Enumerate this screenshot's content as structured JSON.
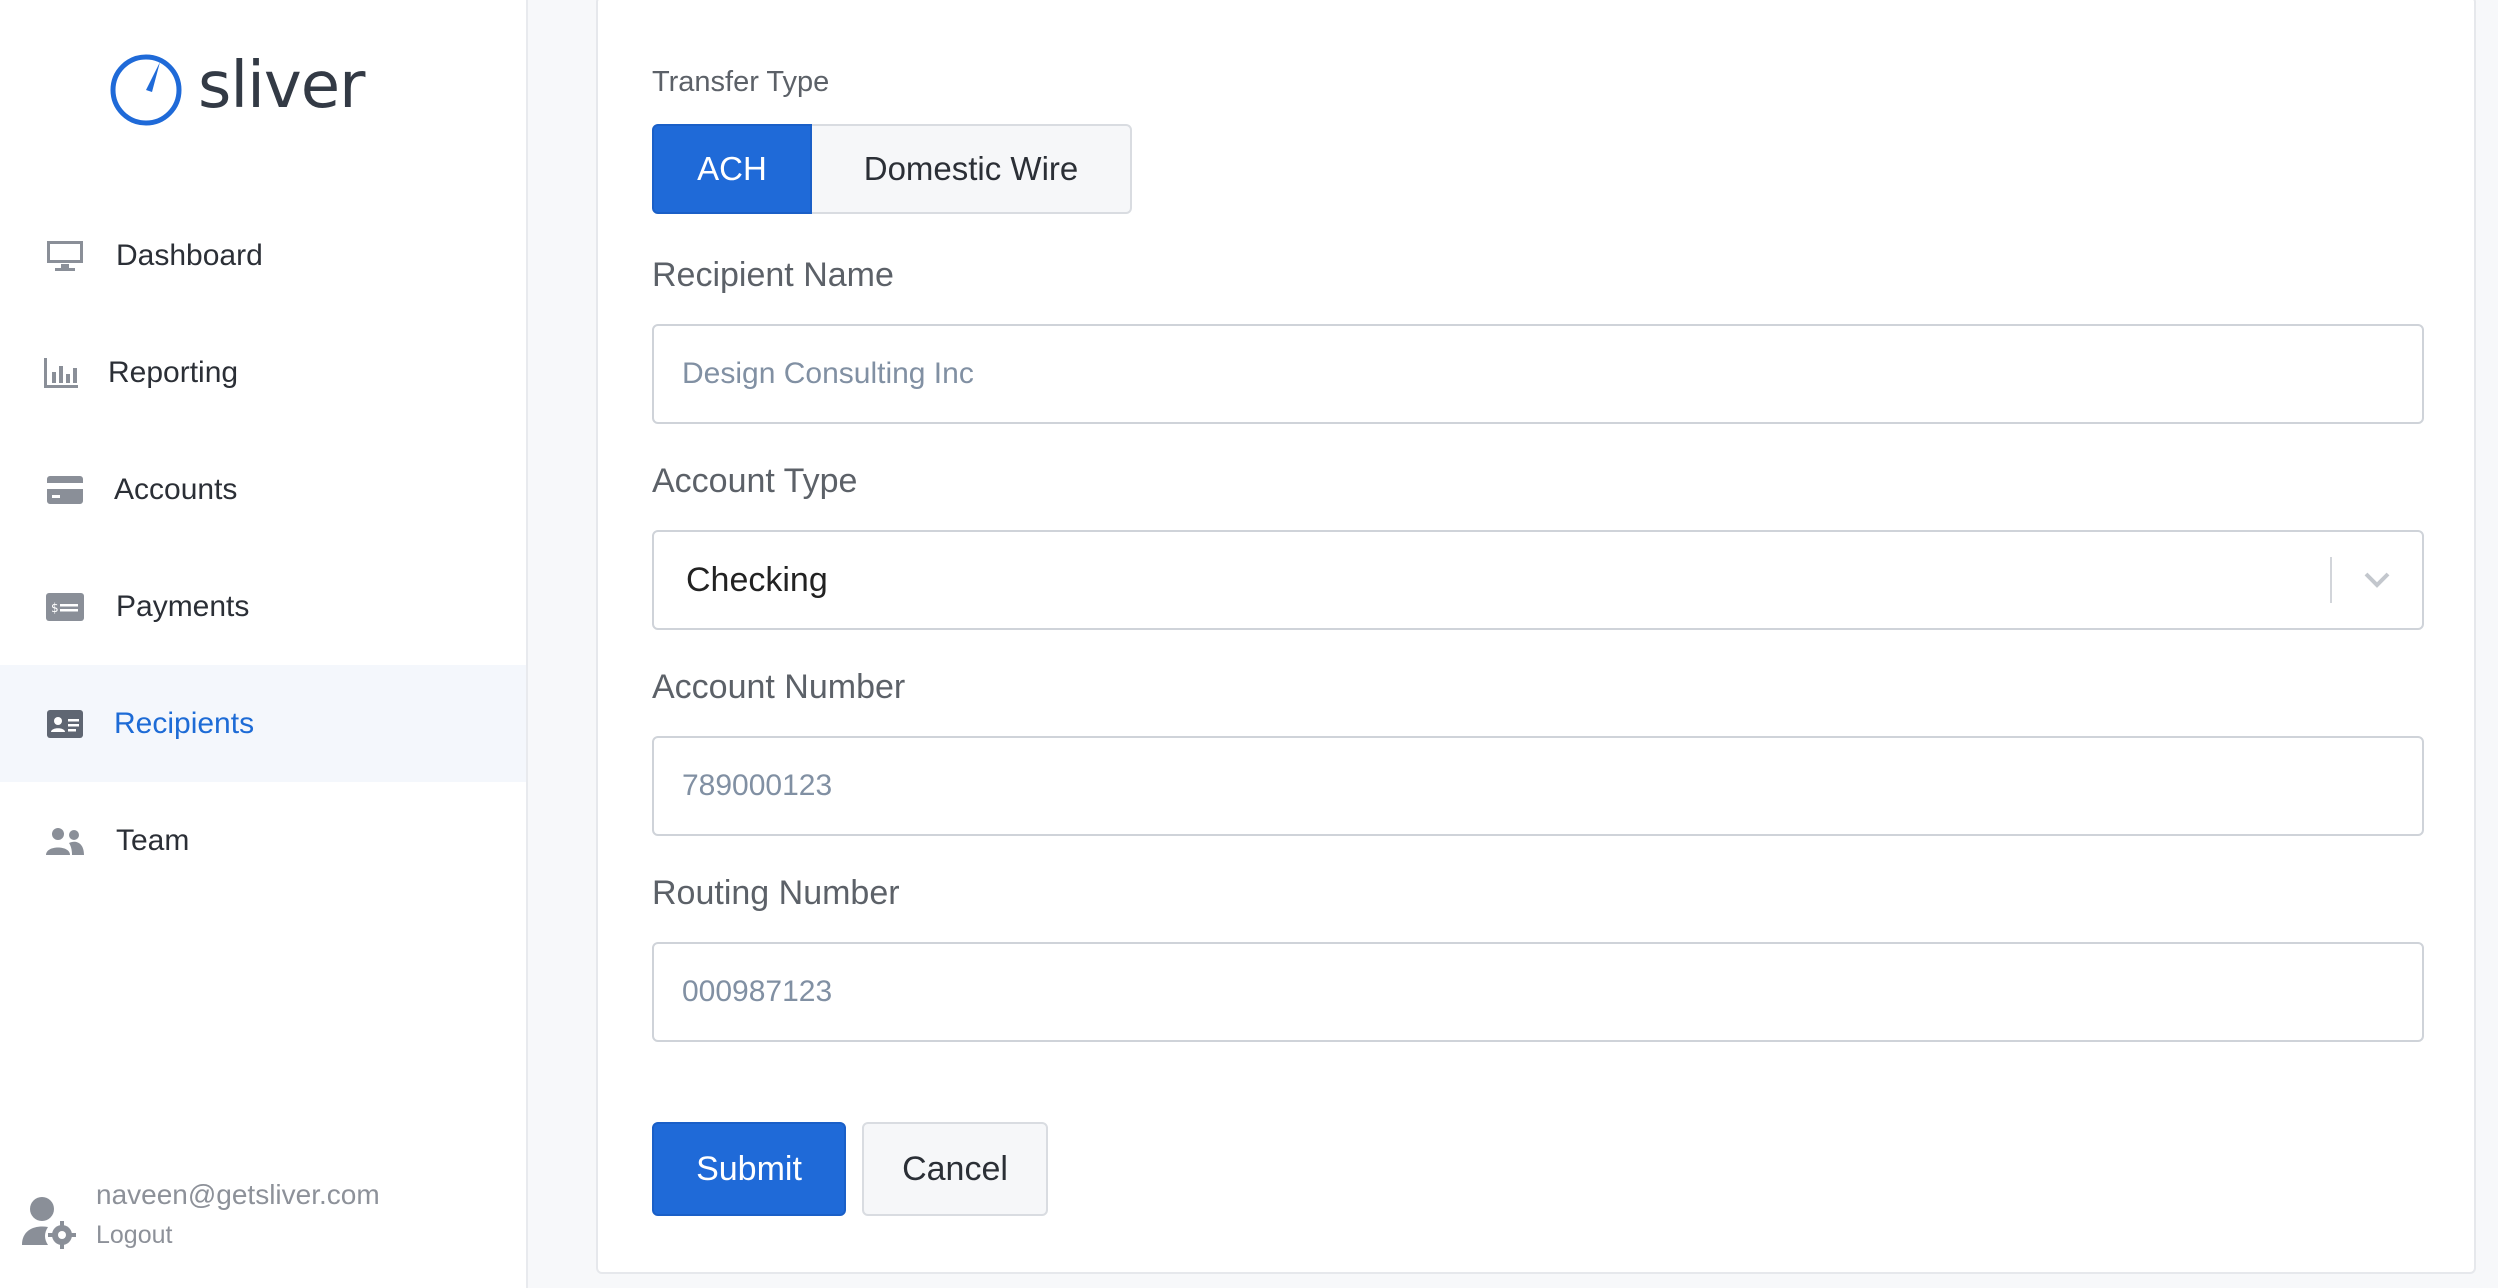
{
  "app": {
    "logo_text": "sliver",
    "accent": "#1f6ad8"
  },
  "sidebar": {
    "items": [
      {
        "label": "Dashboard",
        "icon": "monitor-icon"
      },
      {
        "label": "Reporting",
        "icon": "bar-chart-icon"
      },
      {
        "label": "Accounts",
        "icon": "credit-card-icon"
      },
      {
        "label": "Payments",
        "icon": "money-check-icon"
      },
      {
        "label": "Recipients",
        "icon": "id-card-icon",
        "active": true
      },
      {
        "label": "Team",
        "icon": "users-icon"
      }
    ],
    "user": {
      "email": "naveen@getsliver.com",
      "logout_label": "Logout"
    }
  },
  "form": {
    "transfer_type": {
      "label": "Transfer Type",
      "options": [
        "ACH",
        "Domestic Wire"
      ],
      "selected": "ACH"
    },
    "recipient_name": {
      "label": "Recipient Name",
      "placeholder": "Design Consulting Inc"
    },
    "account_type": {
      "label": "Account Type",
      "value": "Checking"
    },
    "account_number": {
      "label": "Account Number",
      "placeholder": "789000123"
    },
    "routing_number": {
      "label": "Routing Number",
      "placeholder": "000987123"
    },
    "submit_label": "Submit",
    "cancel_label": "Cancel"
  }
}
